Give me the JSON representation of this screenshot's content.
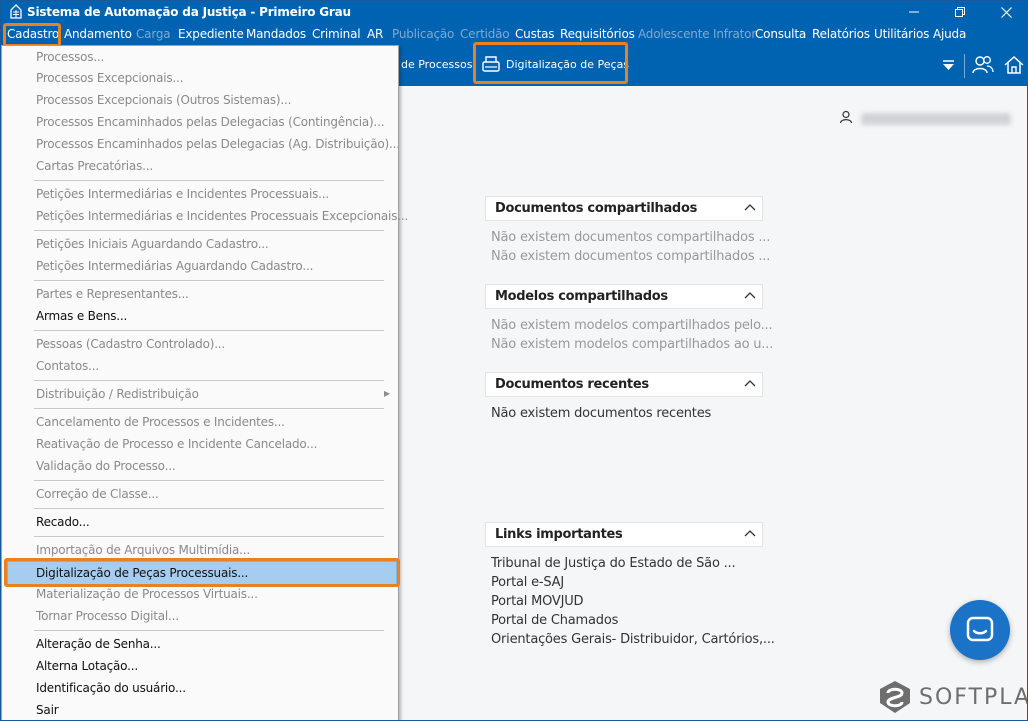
{
  "window": {
    "title": "Sistema de Automação da Justiça - Primeiro Grau"
  },
  "menubar": {
    "items": [
      {
        "label": "Cadastro",
        "enabled": true
      },
      {
        "label": "Andamento",
        "enabled": true
      },
      {
        "label": "Carga",
        "enabled": false
      },
      {
        "label": "Expediente",
        "enabled": true
      },
      {
        "label": "Mandados",
        "enabled": true
      },
      {
        "label": "Criminal",
        "enabled": true
      },
      {
        "label": "AR",
        "enabled": true
      },
      {
        "label": "Publicação",
        "enabled": false
      },
      {
        "label": "Certidão",
        "enabled": false
      },
      {
        "label": "Custas",
        "enabled": true
      },
      {
        "label": "Requisitórios",
        "enabled": true
      },
      {
        "label": "Adolescente Infrator",
        "enabled": false
      },
      {
        "label": "Consulta",
        "enabled": true
      },
      {
        "label": "Relatórios",
        "enabled": true
      },
      {
        "label": "Utilitários",
        "enabled": true
      },
      {
        "label": "Ajuda",
        "enabled": true
      }
    ]
  },
  "toolbar": {
    "partial_label": "de Processos",
    "digitalizacao_label": "Digitalização de Peças"
  },
  "dropdown": {
    "items": [
      {
        "label": "Processos...",
        "enabled": false
      },
      {
        "label": "Processos Excepcionais...",
        "enabled": false
      },
      {
        "label": "Processos Excepcionais (Outros Sistemas)...",
        "enabled": false
      },
      {
        "label": "Processos Encaminhados pelas Delegacias (Contingência)...",
        "enabled": false
      },
      {
        "label": "Processos Encaminhados pelas Delegacias (Ag. Distribuição)...",
        "enabled": false
      },
      {
        "label": "Cartas Precatórias...",
        "enabled": false
      },
      {
        "label": "Petições Intermediárias e Incidentes Processuais...",
        "enabled": false
      },
      {
        "label": "Petições Intermediárias e Incidentes Processuais Excepcionais...",
        "enabled": false
      },
      {
        "label": "Petições Iniciais Aguardando Cadastro...",
        "enabled": false
      },
      {
        "label": "Petições Intermediárias Aguardando Cadastro...",
        "enabled": false
      },
      {
        "label": "Partes e Representantes...",
        "enabled": false
      },
      {
        "label": "Armas e Bens...",
        "enabled": true
      },
      {
        "label": "Pessoas (Cadastro Controlado)...",
        "enabled": false
      },
      {
        "label": "Contatos...",
        "enabled": false
      },
      {
        "label": "Distribuição / Redistribuição",
        "enabled": false
      },
      {
        "label": "Cancelamento de Processos e Incidentes...",
        "enabled": false
      },
      {
        "label": "Reativação de Processo e Incidente Cancelado...",
        "enabled": false
      },
      {
        "label": "Validação do Processo...",
        "enabled": false
      },
      {
        "label": "Correção de Classe...",
        "enabled": false
      },
      {
        "label": "Recado...",
        "enabled": true
      },
      {
        "label": "Importação de Arquivos Multimídia...",
        "enabled": false
      },
      {
        "label": "Digitalização de Peças Processuais...",
        "enabled": true
      },
      {
        "label": "Materialização de Processos Virtuais...",
        "enabled": false
      },
      {
        "label": "Tornar Processo Digital...",
        "enabled": false
      },
      {
        "label": "Alteração de Senha...",
        "enabled": true
      },
      {
        "label": "Alterna Lotação...",
        "enabled": true
      },
      {
        "label": "Identificação do usuário...",
        "enabled": true
      },
      {
        "label": "Sair",
        "enabled": true
      }
    ],
    "submenu_arrow": "▸"
  },
  "panels": {
    "docs_shared": {
      "title": "Documentos compartilhados",
      "lines": [
        "Não existem documentos compartilhados ...",
        "Não existem documentos compartilhados ..."
      ]
    },
    "models_shared": {
      "title": "Modelos compartilhados",
      "lines": [
        "Não existem modelos compartilhados pelo...",
        "Não existem modelos compartilhados ao u..."
      ]
    },
    "recent_docs": {
      "title": "Documentos recentes",
      "lines": [
        "Não existem documentos recentes"
      ]
    },
    "links": {
      "title": "Links importantes",
      "lines": [
        "Tribunal de Justiça do Estado de São ...",
        "Portal e-SAJ",
        "Portal MOVJUD",
        "Portal de Chamados",
        "Orientações Gerais- Distribuidor, Cartórios,..."
      ]
    }
  },
  "brand": {
    "logo_text": "SOFTPLAN"
  },
  "colors": {
    "accent": "#0063b1",
    "highlight": "#e8821e",
    "selection": "#a6cdf0"
  }
}
